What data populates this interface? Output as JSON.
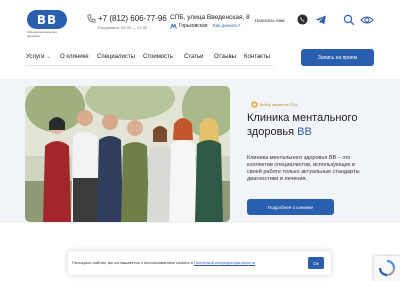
{
  "brand": {
    "logo_letters": "BB",
    "logo_caption": "Клиника ментального здоровья",
    "accent_color": "#2a5fb0"
  },
  "contacts": {
    "phone": "+7 (812) 606-77-96",
    "hours": "Ежедневно, 08:00 — 21:00",
    "address": "СПБ, улица Введенская, 8",
    "metro": "Горьковская",
    "show_map": "Как доехать?",
    "write_us": "Написать нам:"
  },
  "nav": {
    "items": [
      {
        "label": "Услуги",
        "has_dropdown": true
      },
      {
        "label": "О клинике",
        "has_dropdown": false
      },
      {
        "label": "Специалисты",
        "has_dropdown": false
      },
      {
        "label": "Стоимость",
        "has_dropdown": false
      },
      {
        "label": "Статьи",
        "has_dropdown": false
      },
      {
        "label": "Отзывы",
        "has_dropdown": false
      },
      {
        "label": "Контакты",
        "has_dropdown": false
      }
    ],
    "cta_label": "Запись на прием"
  },
  "hero": {
    "badge": "Выбор пациентов 2024",
    "title_main": "Клиника ментального здоровья",
    "title_accent": "ВВ",
    "description": "Клиника ментального здоровья ВВ – это коллектив специалистов, использующих в своей работе только актуальные стандарты диагностики и лечения.",
    "button_label": "Подробнее о клинике"
  },
  "cookie": {
    "text": "Пользуясь сайтом, вы соглашаетесь с использованием cookies и",
    "link": "Политикой конфиденциальности",
    "ok_label": "Ок"
  }
}
